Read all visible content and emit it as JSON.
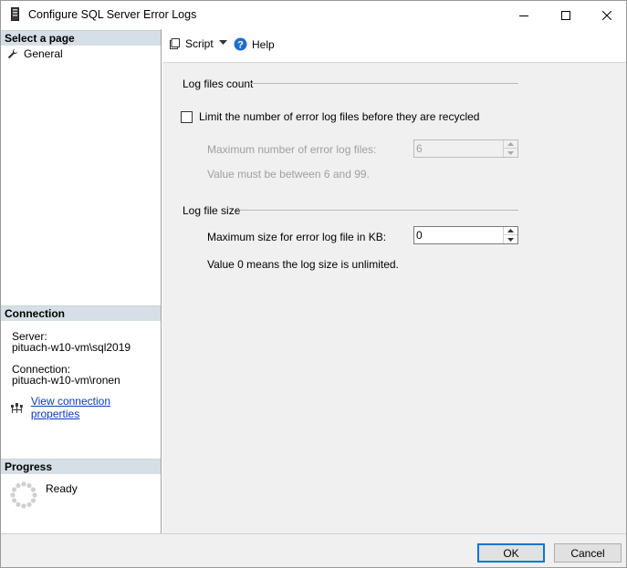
{
  "window": {
    "title": "Configure SQL Server Error Logs"
  },
  "left_panel": {
    "select_page_header": "Select a page",
    "pages": [
      {
        "label": "General",
        "icon": "wrench-icon"
      }
    ],
    "connection": {
      "header": "Connection",
      "server_label": "Server:",
      "server_value": "pituach-w10-vm\\sql2019",
      "connection_label": "Connection:",
      "connection_value": "pituach-w10-vm\\ronen",
      "view_properties_link": "View connection properties"
    },
    "progress": {
      "header": "Progress",
      "status": "Ready"
    }
  },
  "toolbar": {
    "script_label": "Script",
    "help_label": "Help"
  },
  "log_files_count": {
    "group_title": "Log files count",
    "limit_checkbox_label": "Limit the number of error log files before they are recycled",
    "limit_checked": false,
    "max_files_label": "Maximum number of error log files:",
    "max_files_value": "6",
    "range_hint": "Value must be between 6 and 99."
  },
  "log_file_size": {
    "group_title": "Log file size",
    "max_size_label": "Maximum size for error log file in KB:",
    "max_size_value": "0",
    "size_hint": "Value 0 means the log size is unlimited."
  },
  "buttons": {
    "ok_label": "OK",
    "cancel_label": "Cancel"
  },
  "colors": {
    "accent": "#0078d7",
    "section_header_bg": "#d5dfe5",
    "link": "#0b3ac6"
  }
}
